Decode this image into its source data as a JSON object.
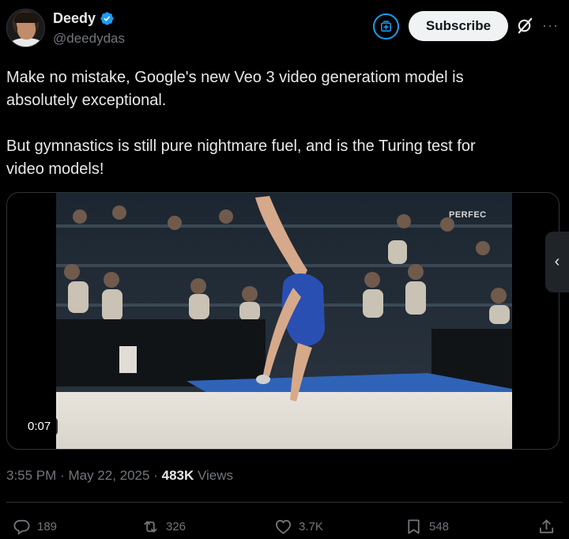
{
  "author": {
    "display_name": "Deedy",
    "handle": "@deedydas",
    "verified": true
  },
  "header": {
    "subscribe_label": "Subscribe",
    "icons": [
      "verified-badge-icon",
      "subscriptions-icon",
      "grok-icon",
      "more-icon"
    ]
  },
  "tweet": {
    "text": "Make no mistake, Google's new Veo 3 video generatiom model is\nabsolutely exceptional.\n\nBut gymnastics is still pure nightmare fuel, and is the Turing test for\nvideo models!"
  },
  "media": {
    "duration": "0:07",
    "overlay_text": "PERFEC",
    "video_progress": 0
  },
  "meta": {
    "time": "3:55 PM",
    "separator": "·",
    "date": "May 22, 2025",
    "views_count": "483K",
    "views_label": "Views"
  },
  "actions": {
    "replies": "189",
    "reposts": "326",
    "likes": "3.7K",
    "bookmarks": "548"
  },
  "colors": {
    "background": "#000000",
    "text_primary": "#e7e9ea",
    "text_secondary": "#71767b",
    "accent": "#1d9bf0",
    "subscribe_bg": "#eff3f4"
  }
}
